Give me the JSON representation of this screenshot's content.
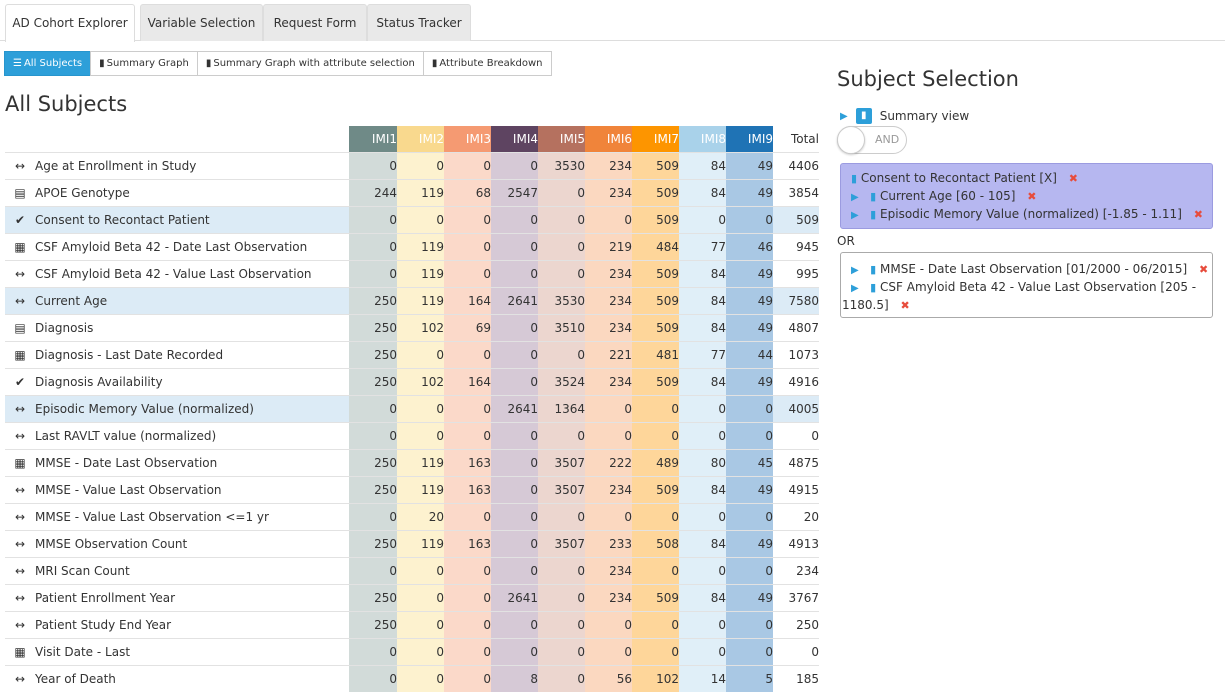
{
  "tabs": [
    "AD Cohort Explorer",
    "Variable Selection",
    "Request Form",
    "Status Tracker"
  ],
  "subnav": [
    {
      "icon": "list-icon",
      "glyph": "☰",
      "label": "All Subjects"
    },
    {
      "icon": "bar-chart-icon",
      "glyph": "▮",
      "label": "Summary Graph"
    },
    {
      "icon": "bar-chart-icon",
      "glyph": "▮",
      "label": "Summary Graph with attribute selection"
    },
    {
      "icon": "bar-chart-icon",
      "glyph": "▮",
      "label": "Attribute Breakdown"
    }
  ],
  "heading": "All Subjects",
  "columns": [
    {
      "label": "IMI1",
      "head": "#6f8a87",
      "cell": "#d2dbd9"
    },
    {
      "label": "IMI2",
      "head": "#f9d98e",
      "cell": "#fdf2cf"
    },
    {
      "label": "IMI3",
      "head": "#f59a72",
      "cell": "#fbd9c9"
    },
    {
      "label": "IMI4",
      "head": "#5e4461",
      "cell": "#d6c9d6"
    },
    {
      "label": "IMI5",
      "head": "#b5715f",
      "cell": "#ecd6cf"
    },
    {
      "label": "IMI6",
      "head": "#f0843a",
      "cell": "#fbd8c0"
    },
    {
      "label": "IMI7",
      "head": "#fd9500",
      "cell": "#fed69a"
    },
    {
      "label": "IMI8",
      "head": "#a9d2ea",
      "cell": "#e0eff8"
    },
    {
      "label": "IMI9",
      "head": "#1f73b5",
      "cell": "#a9c8e4"
    }
  ],
  "total_label": "Total",
  "rows": [
    {
      "icon": "arrows-horizontal-icon",
      "glyph": "↔",
      "label": "Age at Enrollment in Study",
      "values": [
        0,
        0,
        0,
        0,
        3530,
        234,
        509,
        84,
        49
      ],
      "total": 4406,
      "hl": false
    },
    {
      "icon": "list-alt-icon",
      "glyph": "▤",
      "label": "APOE Genotype",
      "values": [
        244,
        119,
        68,
        2547,
        0,
        234,
        509,
        84,
        49
      ],
      "total": 3854,
      "hl": false
    },
    {
      "icon": "check-icon",
      "glyph": "✔",
      "label": "Consent to Recontact Patient",
      "values": [
        0,
        0,
        0,
        0,
        0,
        0,
        509,
        0,
        0
      ],
      "total": 509,
      "hl": true
    },
    {
      "icon": "calendar-icon",
      "glyph": "▦",
      "label": "CSF Amyloid Beta 42 - Date Last Observation",
      "values": [
        0,
        119,
        0,
        0,
        0,
        219,
        484,
        77,
        46
      ],
      "total": 945,
      "hl": false
    },
    {
      "icon": "arrows-horizontal-icon",
      "glyph": "↔",
      "label": "CSF Amyloid Beta 42 - Value Last Observation",
      "values": [
        0,
        119,
        0,
        0,
        0,
        234,
        509,
        84,
        49
      ],
      "total": 995,
      "hl": false
    },
    {
      "icon": "arrows-horizontal-icon",
      "glyph": "↔",
      "label": "Current Age",
      "values": [
        250,
        119,
        164,
        2641,
        3530,
        234,
        509,
        84,
        49
      ],
      "total": 7580,
      "hl": true
    },
    {
      "icon": "list-alt-icon",
      "glyph": "▤",
      "label": "Diagnosis",
      "values": [
        250,
        102,
        69,
        0,
        3510,
        234,
        509,
        84,
        49
      ],
      "total": 4807,
      "hl": false
    },
    {
      "icon": "calendar-icon",
      "glyph": "▦",
      "label": "Diagnosis - Last Date Recorded",
      "values": [
        250,
        0,
        0,
        0,
        0,
        221,
        481,
        77,
        44
      ],
      "total": 1073,
      "hl": false
    },
    {
      "icon": "check-icon",
      "glyph": "✔",
      "label": "Diagnosis Availability",
      "values": [
        250,
        102,
        164,
        0,
        3524,
        234,
        509,
        84,
        49
      ],
      "total": 4916,
      "hl": false
    },
    {
      "icon": "arrows-horizontal-icon",
      "glyph": "↔",
      "label": "Episodic Memory Value (normalized)",
      "values": [
        0,
        0,
        0,
        2641,
        1364,
        0,
        0,
        0,
        0
      ],
      "total": 4005,
      "hl": true
    },
    {
      "icon": "arrows-horizontal-icon",
      "glyph": "↔",
      "label": "Last RAVLT value (normalized)",
      "values": [
        0,
        0,
        0,
        0,
        0,
        0,
        0,
        0,
        0
      ],
      "total": 0,
      "hl": false
    },
    {
      "icon": "calendar-icon",
      "glyph": "▦",
      "label": "MMSE - Date Last Observation",
      "values": [
        250,
        119,
        163,
        0,
        3507,
        222,
        489,
        80,
        45
      ],
      "total": 4875,
      "hl": false
    },
    {
      "icon": "arrows-horizontal-icon",
      "glyph": "↔",
      "label": "MMSE - Value Last Observation",
      "values": [
        250,
        119,
        163,
        0,
        3507,
        234,
        509,
        84,
        49
      ],
      "total": 4915,
      "hl": false
    },
    {
      "icon": "arrows-horizontal-icon",
      "glyph": "↔",
      "label": "MMSE - Value Last Observation <=1 yr",
      "values": [
        0,
        20,
        0,
        0,
        0,
        0,
        0,
        0,
        0
      ],
      "total": 20,
      "hl": false
    },
    {
      "icon": "arrows-horizontal-icon",
      "glyph": "↔",
      "label": "MMSE Observation Count",
      "values": [
        250,
        119,
        163,
        0,
        3507,
        233,
        508,
        84,
        49
      ],
      "total": 4913,
      "hl": false
    },
    {
      "icon": "arrows-horizontal-icon",
      "glyph": "↔",
      "label": "MRI Scan Count",
      "values": [
        0,
        0,
        0,
        0,
        0,
        234,
        0,
        0,
        0
      ],
      "total": 234,
      "hl": false
    },
    {
      "icon": "arrows-horizontal-icon",
      "glyph": "↔",
      "label": "Patient Enrollment Year",
      "values": [
        250,
        0,
        0,
        2641,
        0,
        234,
        509,
        84,
        49
      ],
      "total": 3767,
      "hl": false
    },
    {
      "icon": "arrows-horizontal-icon",
      "glyph": "↔",
      "label": "Patient Study End Year",
      "values": [
        250,
        0,
        0,
        0,
        0,
        0,
        0,
        0,
        0
      ],
      "total": 250,
      "hl": false
    },
    {
      "icon": "calendar-icon",
      "glyph": "▦",
      "label": "Visit Date - Last",
      "values": [
        0,
        0,
        0,
        0,
        0,
        0,
        0,
        0,
        0
      ],
      "total": 0,
      "hl": false
    },
    {
      "icon": "arrows-horizontal-icon",
      "glyph": "↔",
      "label": "Year of Death",
      "values": [
        0,
        0,
        0,
        8,
        0,
        56,
        102,
        14,
        5
      ],
      "total": 185,
      "hl": false
    }
  ],
  "selection": {
    "title": "Subject Selection",
    "summary_label": "Summary view",
    "toggle_label": "AND",
    "group1": {
      "line1": "Consent to Recontact Patient [X]",
      "line2": "Current Age [60 - 105]",
      "line3": "Episodic Memory Value (normalized) [-1.85 - 1.11]"
    },
    "or_label": "OR",
    "group2": {
      "line1": "MMSE - Date Last Observation [01/2000 - 06/2015]",
      "line2a": "CSF Amyloid Beta 42 - Value Last Observation [205 -",
      "line2b": "1180.5]"
    },
    "remove_glyph": "✖"
  }
}
